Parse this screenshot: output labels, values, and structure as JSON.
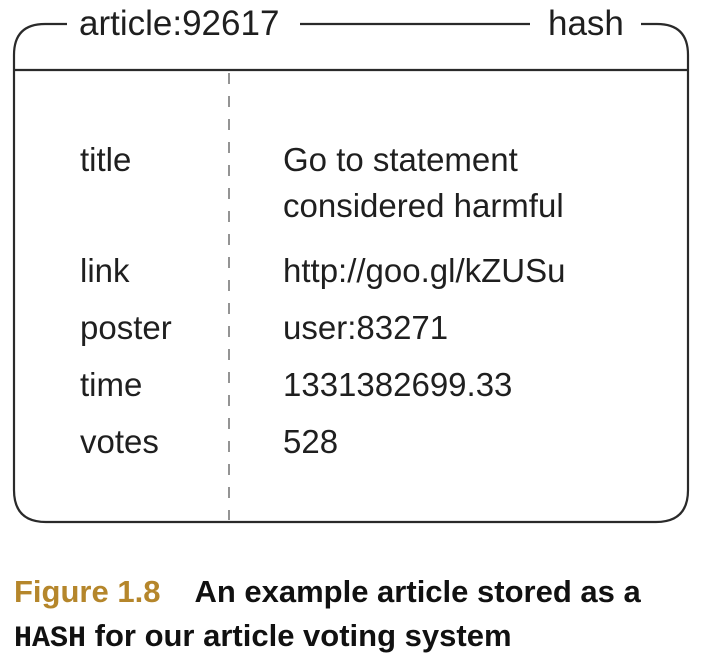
{
  "hash": {
    "name": "article:92617",
    "type": "hash",
    "fields": [
      {
        "key": "title",
        "value": "Go to statement considered harmful"
      },
      {
        "key": "link",
        "value": "http://goo.gl/kZUSu"
      },
      {
        "key": "poster",
        "value": "user:83271"
      },
      {
        "key": "time",
        "value": "1331382699.33"
      },
      {
        "key": "votes",
        "value": "528"
      }
    ]
  },
  "caption": {
    "figure_number": "Figure 1.8",
    "text_part1": "An example article stored as a ",
    "code_word": "HASH",
    "text_part2": " for our article voting system"
  },
  "colors": {
    "frame_stroke": "#2a2a2a",
    "divider_stroke": "#7a7a7a",
    "figure_number": "#b5862b"
  }
}
